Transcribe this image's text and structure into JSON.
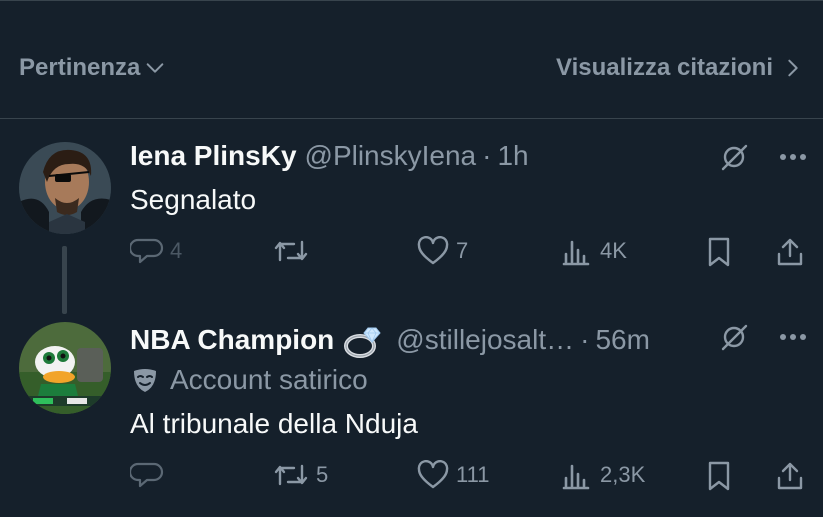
{
  "sort": {
    "label": "Pertinenza",
    "quotes_label": "Visualizza citazioni"
  },
  "tweets": [
    {
      "name": "Iena PlinsKy",
      "handle": "@PlinskyIena",
      "separator": "·",
      "time": "1h",
      "text": "Segnalato",
      "replies": "4",
      "retweets": "",
      "likes": "7",
      "views": "4K"
    },
    {
      "name": "NBA Champion",
      "emoji": "ring",
      "handle": "@stillejosalt…",
      "separator": "·",
      "time": "56m",
      "label": "Account satirico",
      "text": "Al tribunale della Nduja",
      "replies": "",
      "retweets": "5",
      "likes": "111",
      "views": "2,3K"
    }
  ],
  "colors": {
    "background": "#15202b",
    "primary_text": "#f7f9f9",
    "secondary_text": "#8b98a5",
    "divider": "#38444d"
  },
  "icons": [
    "chevron-down-icon",
    "chevron-right-icon",
    "grok-icon",
    "more-icon",
    "reply-icon",
    "retweet-icon",
    "like-icon",
    "views-icon",
    "bookmark-icon",
    "share-icon",
    "ring-emoji-icon",
    "mask-icon"
  ]
}
